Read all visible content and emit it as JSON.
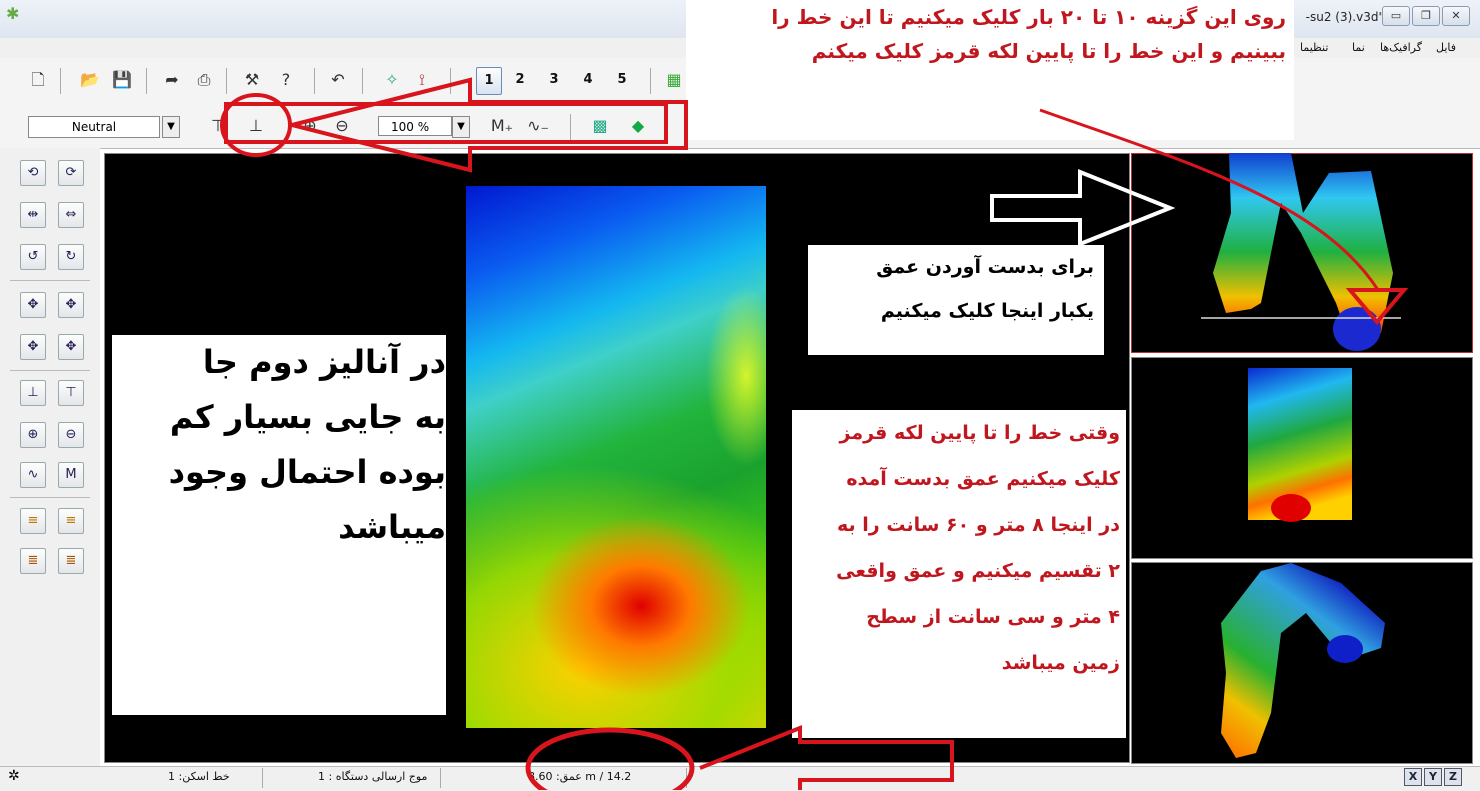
{
  "window": {
    "title": "-su2 (3).v3d\"",
    "minimize_icon": "minimize-icon",
    "restore_icon": "restore-icon",
    "close_icon": "close-icon"
  },
  "menu": [
    "فایل",
    "گرافیک‌ها",
    "نما",
    "تنظیما"
  ],
  "toolbar1": {
    "view_numbers": [
      "1",
      "2",
      "3",
      "4",
      "5"
    ],
    "selected_view": "1"
  },
  "toolbar2": {
    "palette": "Neutral",
    "zoom": "100 %"
  },
  "annotations": {
    "top": [
      "روی این گزینه ۱۰ تا ۲۰ بار کلیک میکنیم تا این خط  را",
      "ببینیم و این خط را تا پایین لکه قرمز کلیک میکنم"
    ],
    "depth": [
      "برای بدست آوردن عمق",
      "یکبار اینجا کلیک میکنیم"
    ],
    "result": [
      "وقتی خط را تا پایین لکه قرمز",
      "کلیک میکنیم عمق بدست آمده",
      "در اینجا ۸ متر و ۶۰ سانت را به",
      "۲ تقسیم میکنیم و عمق واقعی",
      "۴ متر و سی سانت از سطح",
      "زمین میباشد"
    ],
    "analysis": [
      "در آنالیز دوم جا",
      "به جایی بسیار کم",
      "بوده احتمال وجود",
      "میباشد"
    ]
  },
  "status": {
    "scan_line": "خط اسکن: 1",
    "device_wave": "موج ارسالی دستگاه : 1",
    "depth": "عمق: 8.60 m / 14.2"
  },
  "axes_buttons": [
    "X",
    "Y",
    "Z"
  ],
  "colors": {
    "annotation_red": "#c0171f",
    "marker_red": "#d8141c"
  }
}
